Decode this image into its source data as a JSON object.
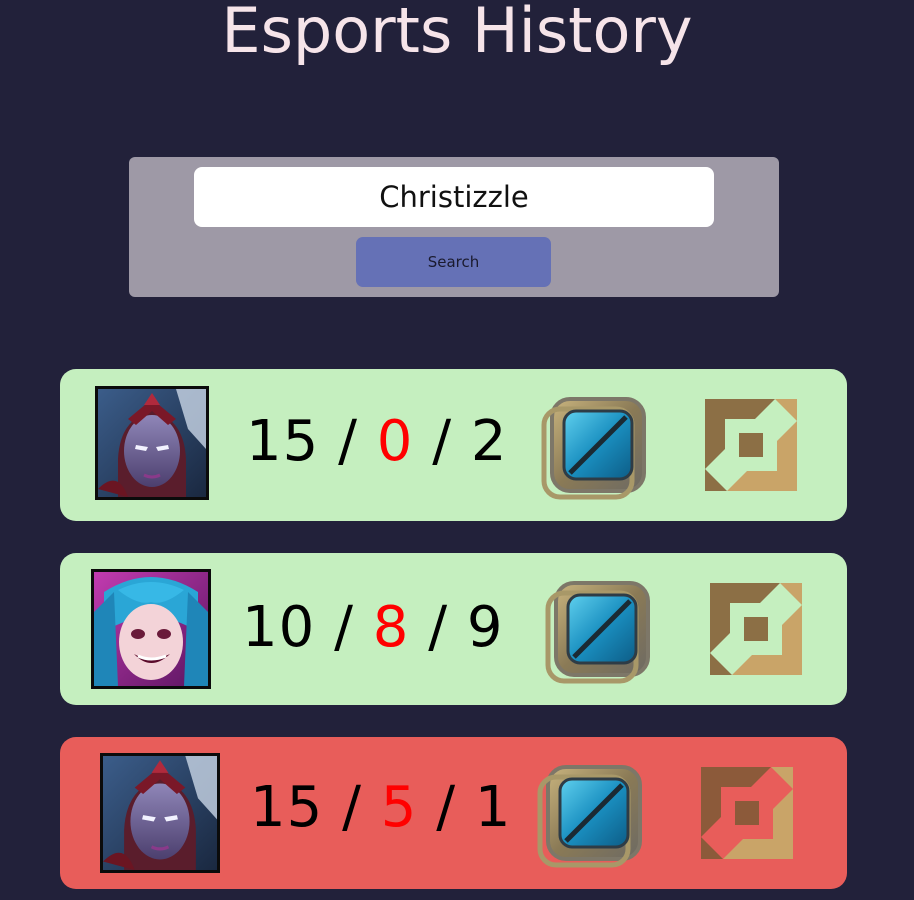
{
  "page": {
    "title": "Esports History"
  },
  "search": {
    "value": "Christizzle",
    "button_label": "Search"
  },
  "colors": {
    "background": "#22213a",
    "panel": "#9e99a6",
    "button": "#6571b6",
    "win": "#c5efbf",
    "loss": "#e85d5a",
    "deaths": "#ff0000",
    "title": "#f6e4e9"
  },
  "matches": [
    {
      "result": "win",
      "champion_icon": "varus-portrait-icon",
      "kills": "15",
      "sep1": "/",
      "deaths": "0",
      "sep2": "/",
      "assists": "2",
      "rank_icon": "rank-emblem-icon",
      "role_icon": "role-mid-icon"
    },
    {
      "result": "win",
      "champion_icon": "jinx-portrait-icon",
      "kills": "10",
      "sep1": "/",
      "deaths": "8",
      "sep2": "/",
      "assists": "9",
      "rank_icon": "rank-emblem-icon",
      "role_icon": "role-mid-icon"
    },
    {
      "result": "loss",
      "champion_icon": "varus-portrait-icon",
      "kills": "15",
      "sep1": "/",
      "deaths": "5",
      "sep2": "/",
      "assists": "1",
      "rank_icon": "rank-emblem-icon",
      "role_icon": "role-mid-icon"
    }
  ]
}
